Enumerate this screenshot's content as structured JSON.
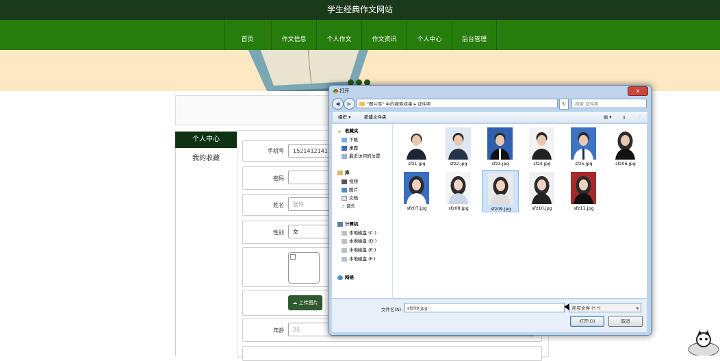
{
  "site": {
    "title": "学生经典作文网站"
  },
  "nav": [
    "首页",
    "作文信息",
    "个人作文",
    "作文资讯",
    "个人中心",
    "后台管理"
  ],
  "sidebar": {
    "header": "个人中心",
    "items": [
      "我的收藏"
    ]
  },
  "form": {
    "phone_label": "手机号",
    "phone_value": "15214121411",
    "password_label": "密码",
    "password_value": "·",
    "name_label": "姓名",
    "name_value": "张玲",
    "gender_label": "性别",
    "gender_value": "女",
    "upload_label": "上传图片",
    "age_label": "年龄",
    "age_value": "25"
  },
  "dialog": {
    "title": "打开",
    "close": "x",
    "path_prefix": "\"图片库\" 中的搜索结果",
    "path_sep": "▸",
    "path_folder": "证件照",
    "search_placeholder": "搜索 证件照",
    "organize": "组织 ▾",
    "new_folder": "新建文件夹",
    "nav": {
      "favorites": "收藏夹",
      "downloads": "下载",
      "desktop": "桌面",
      "recent": "最近访问的位置",
      "library": "库",
      "videos": "视频",
      "pictures": "图片",
      "documents": "文档",
      "music": "音乐",
      "computer": "计算机",
      "disk_c": "本地磁盘 (C:)",
      "disk_d": "本地磁盘 (D:)",
      "disk_e": "本地磁盘 (E:)",
      "disk_f": "本地磁盘 (F:)",
      "network": "网络"
    },
    "files": [
      "sfz1.jpg",
      "sfz2.jpg",
      "sfz3.jpg",
      "sfz4.jpg",
      "sfz5.jpg",
      "sfz06.jpg",
      "sfz07.jpg",
      "sfz08.jpg",
      "sfz09.jpg",
      "sfz10.jpg",
      "sfz11.jpg"
    ],
    "filename_label": "文件名(N):",
    "filename_value": "sfz09.jpg",
    "filetype_value": "所有文件 (*.*)",
    "open_button": "打开(O)",
    "cancel_button": "取消"
  },
  "colors": {
    "nav_green": "#267d0c",
    "top_dark": "#1b3a1b",
    "banner": "#fde8c4"
  }
}
